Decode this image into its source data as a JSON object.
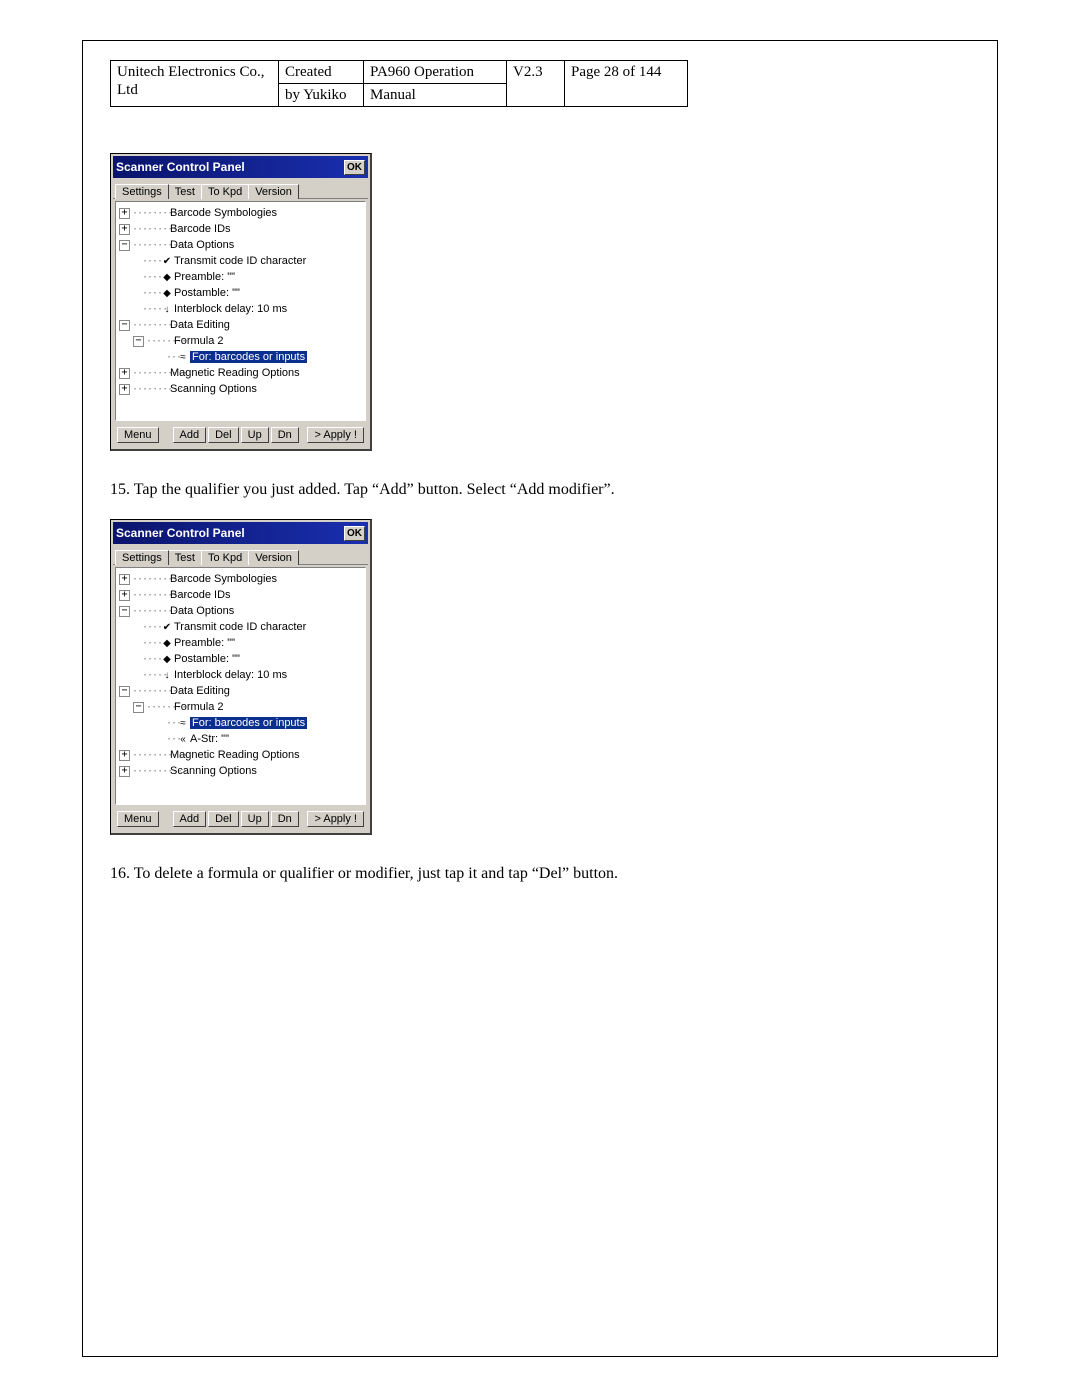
{
  "header": {
    "company": "Unitech Electronics Co., Ltd",
    "created_l1": "Created",
    "created_l2": "by Yukiko",
    "doc_l1": "PA960 Operation",
    "doc_l2": "Manual",
    "version": "V2.3",
    "page": "Page 28 of 144"
  },
  "steps": {
    "s15": "15. Tap the qualifier you just added. Tap “Add” button. Select “Add modifier”.",
    "s16": "16. To delete a formula or qualifier or modifier, just tap it and tap “Del” button."
  },
  "panel": {
    "title": "Scanner Control Panel",
    "ok": "OK",
    "tabs": {
      "t1": "Settings",
      "t2": "Test",
      "t3": "To Kpd",
      "t4": "Version"
    },
    "buttons": {
      "menu": "Menu",
      "add": "Add",
      "del": "Del",
      "up": "Up",
      "dn": "Dn",
      "apply": "> Apply !"
    },
    "tree": {
      "barcode_symbologies": "Barcode Symbologies",
      "barcode_ids": "Barcode IDs",
      "data_options": "Data Options",
      "transmit": "Transmit code ID character",
      "preamble": "Preamble: \"\"",
      "postamble": "Postamble: \"\"",
      "interblock": "Interblock delay: 10 ms",
      "data_editing": "Data Editing",
      "formula2": "Formula 2",
      "for_barcodes": "For: barcodes or inputs",
      "astr": "A-Str: \"\"",
      "magnetic": "Magnetic Reading Options",
      "scanning": "Scanning Options"
    }
  }
}
